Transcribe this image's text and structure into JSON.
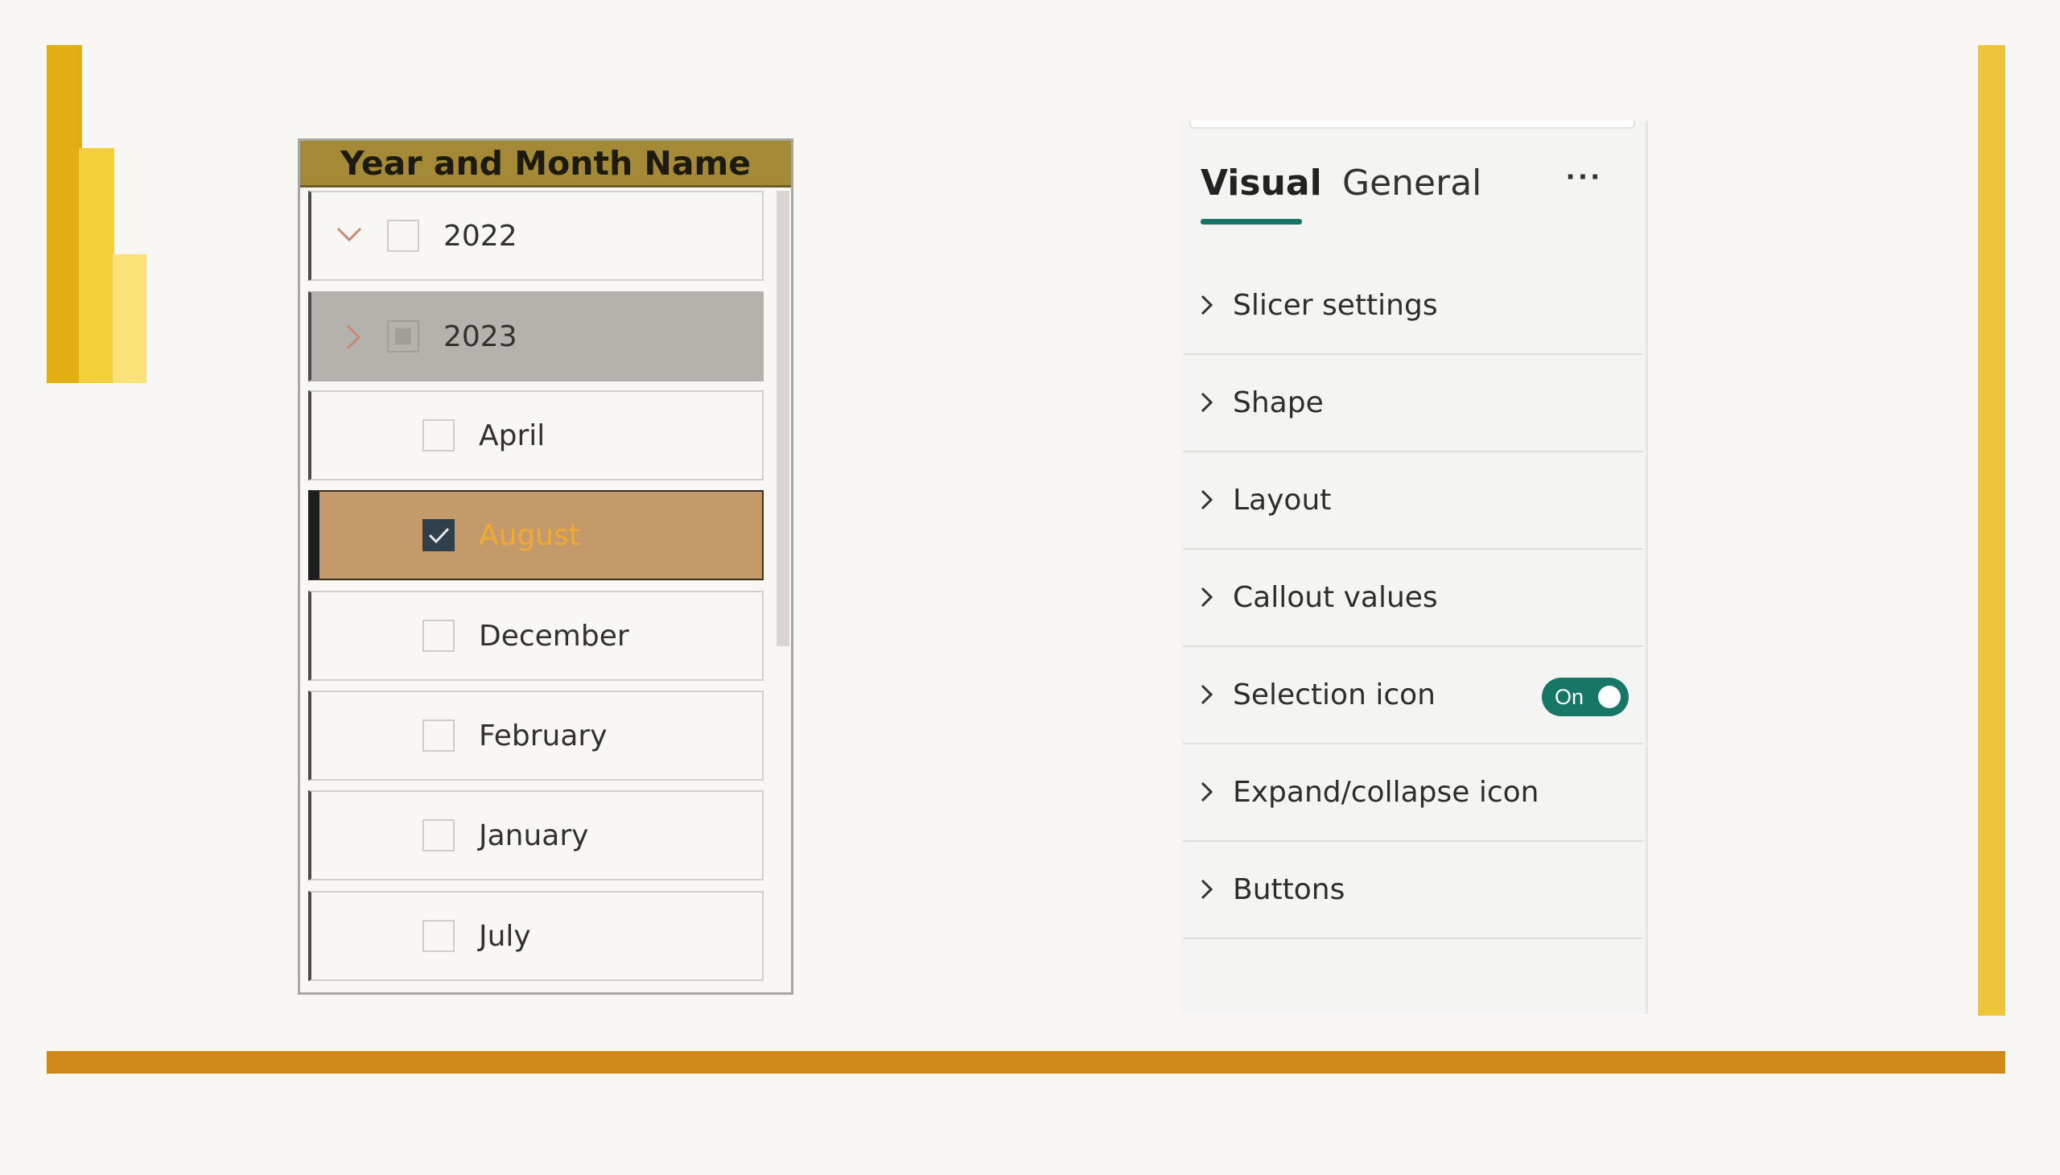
{
  "colors": {
    "background": "#f8f7f3",
    "accent_teal": "#177767",
    "accent_gold": "#eec43a",
    "accent_orange": "#cf8a1a",
    "selected_fill": "#c49a6b",
    "selected_text": "#f2a933",
    "header_fill": "#a48a37"
  },
  "logo": {
    "icon": "power-bi-logo-icon"
  },
  "slicer": {
    "title": "Year and Month Name",
    "items": [
      {
        "label": "2022",
        "level": 0,
        "expanded": true,
        "checked": false
      },
      {
        "label": "2023",
        "level": 0,
        "expanded": false,
        "checked": "partial",
        "hovered": true
      },
      {
        "label": "April",
        "level": 1,
        "checked": false
      },
      {
        "label": "August",
        "level": 1,
        "checked": true
      },
      {
        "label": "December",
        "level": 1,
        "checked": false
      },
      {
        "label": "February",
        "level": 1,
        "checked": false
      },
      {
        "label": "January",
        "level": 1,
        "checked": false
      },
      {
        "label": "July",
        "level": 1,
        "checked": false
      }
    ]
  },
  "format_pane": {
    "tabs": [
      {
        "label": "Visual",
        "active": true
      },
      {
        "label": "General",
        "active": false
      }
    ],
    "more_label": "···",
    "sections": [
      {
        "label": "Slicer settings"
      },
      {
        "label": "Shape"
      },
      {
        "label": "Layout"
      },
      {
        "label": "Callout values"
      },
      {
        "label": "Selection icon",
        "toggle": "On"
      },
      {
        "label": "Expand/collapse icon"
      },
      {
        "label": "Buttons"
      }
    ]
  }
}
